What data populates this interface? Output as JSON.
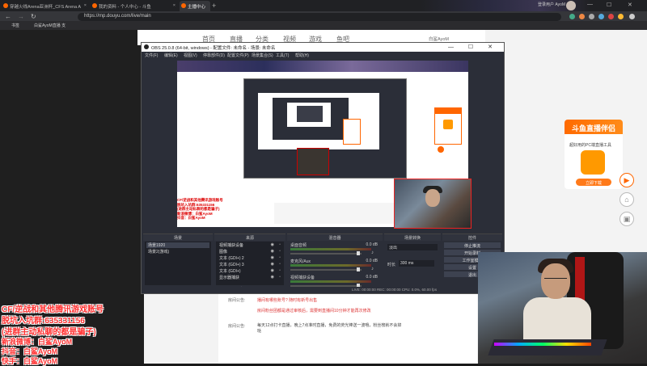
{
  "browser": {
    "tabs": [
      {
        "label": "穿越火线Arena亚洲杯_CFS Arena A",
        "active": false
      },
      {
        "label": "我的资料 - 个人中心 - 斗鱼",
        "active": false
      },
      {
        "label": "主播中心",
        "active": true
      }
    ],
    "url": "https://mp.douyu.com/live/main",
    "bookmarks": [
      "书签",
      "白鲨AyoM直播 支"
    ],
    "header_user": "登录用户 AyoM"
  },
  "douyu_nav": {
    "items": [
      "首页",
      "直播",
      "分类",
      "视频",
      "游戏",
      "鱼吧"
    ],
    "user": "白鲨AyoM"
  },
  "obs": {
    "title": "OBS 25.0.8 (64-bit, windows) - 配置文件: 未命名 - 场景: 未命名",
    "menu": [
      "文件(F)",
      "编辑(E)",
      "视图(V)",
      "停靠部件(D)",
      "配置文件(P)",
      "场景集合(S)",
      "工具(T)",
      "帮助(H)"
    ],
    "docks": {
      "scenes": {
        "title": "场景",
        "items": [
          "场景1920",
          "场景2(游戏)"
        ]
      },
      "sources": {
        "title": "来源",
        "items": [
          "视频捕获设备",
          "图像",
          "文本 (GDI+) 2",
          "文本 (GDI+) 3",
          "文本 (GDI+)",
          "显示器捕获"
        ]
      },
      "mixer": {
        "title": "混音器",
        "channels": [
          {
            "name": "桌面音频",
            "db": "0.0 dB"
          },
          {
            "name": "麦克风/Aux",
            "db": "0.0 dB"
          },
          {
            "name": "视频捕获设备",
            "db": "0.0 dB"
          }
        ]
      },
      "transitions": {
        "title": "场景转换",
        "type": "淡出",
        "duration_label": "时长",
        "duration": "300 ms"
      },
      "controls": {
        "title": "控件",
        "buttons": [
          "停止推流",
          "开始录制",
          "工作室模式",
          "设置",
          "退出"
        ]
      }
    },
    "status": "LIVE: 00:00:00  REC: 00:00:00  CPU: 0.0%, 60.00 fps"
  },
  "preview_text": "CF/逆战和其他腾讯游戏账号\n脱坑入坑群:635331156\n(进群主动私聊的都是骗子)\n新浪微博：白鲨AyoM\n抖音：白鲨AyoM",
  "info_panel": {
    "row1_label": "房间公告:",
    "row1_red": "播间有哪些账号? 随时有新号出售",
    "row2_red": "房间粉丝团都是通过审核后，需要到直播间10分钟才能再次修改",
    "row3_label": "房间公告:",
    "row3_text": "每天12点打卡直播，晚上7点准时直播，免费的荧光棒送一波哦，粉丝榜就不会掉哒"
  },
  "ad": {
    "title": "斗鱼直播伴侣",
    "desc": "超好用的PC端直播工具",
    "button": "立即下载"
  },
  "overlay": {
    "line1": "CF/逆战和其他腾讯游戏账号",
    "line2": "脱坑入坑群:635331156",
    "line3": "(进群主动私聊的都是骗子)",
    "line4": "新浪微博：白鲨AyoM",
    "line5": "抖音：白鲨AyoM",
    "line6": "快手：白鲨AyoM"
  },
  "colors": {
    "brand": "#ff6a00",
    "overlay_text": "#ff3030",
    "obs_bg": "#2b2e38"
  }
}
